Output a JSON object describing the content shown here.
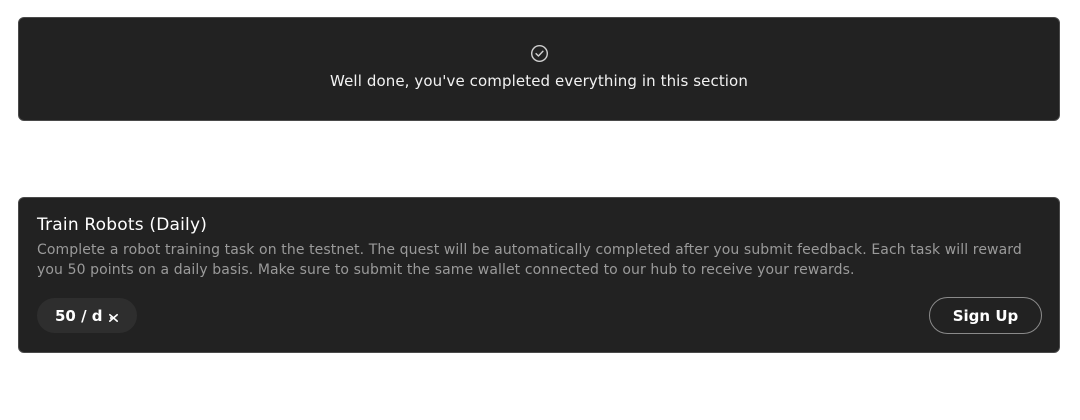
{
  "completion_banner": {
    "icon": "check-circle-icon",
    "message": "Well done, you've completed everything in this section"
  },
  "quest": {
    "title": "Train Robots (Daily)",
    "description": "Complete a robot training task on the testnet. The quest will be automatically completed after you submit feedback. Each task will reward you 50 points on a daily basis. Make sure to submit the same wallet connected to our hub to receive your rewards.",
    "points_label": "50 / d",
    "points_icon": "points-token-icon",
    "action_label": "Sign Up"
  },
  "colors": {
    "card_background": "#222222",
    "card_border": "#4a4a4a",
    "description_text": "#9a9a9a",
    "badge_background": "#2e2e2e"
  }
}
